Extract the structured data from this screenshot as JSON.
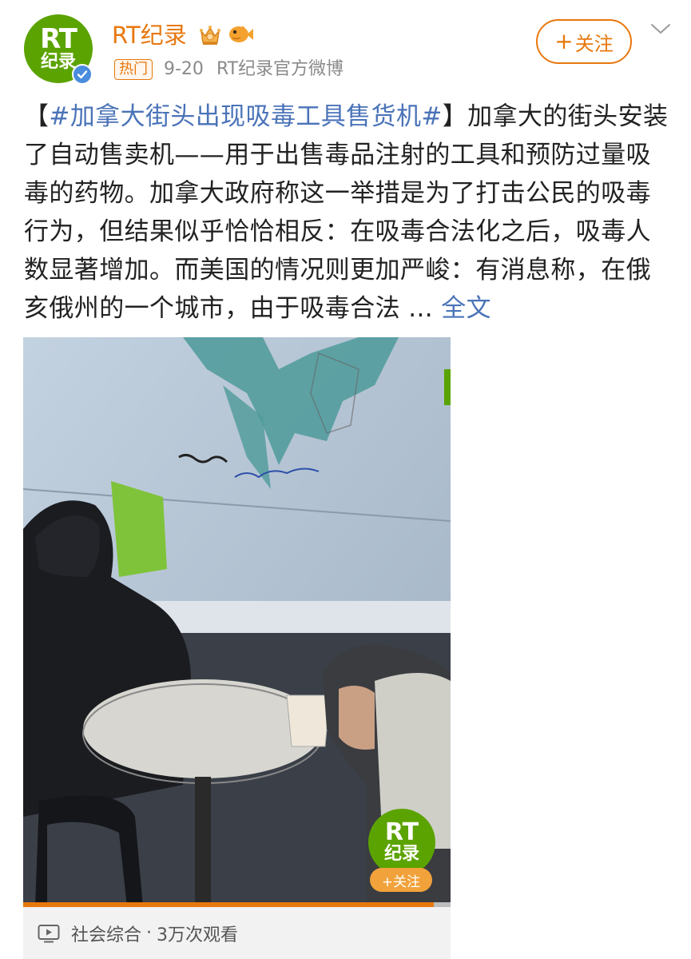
{
  "header": {
    "avatar": {
      "line1": "RT",
      "line2": "纪录"
    },
    "account_name": "RT纪录",
    "hot_tag": "热门",
    "date": "9-20",
    "source": "RT纪录官方微博",
    "follow_label": "关注",
    "follow_plus": "+"
  },
  "post": {
    "bracket_open": "【",
    "hashtag": "#加拿大街头出现吸毒工具售货机#",
    "bracket_close": "】",
    "body": "加拿大的街头安装了自动售卖机——用于出售毒品注射的工具和预防过量吸毒的药物。加拿大政府称这一举措是为了打击公民的吸毒行为，但结果似乎恰恰相反：在吸毒合法化之后，吸毒人数显著增加。而美国的情况则更加严峻：有消息称，在俄亥俄州的一个城市，由于吸毒合法 ... ",
    "full_text_link": "全文"
  },
  "video": {
    "watermark": {
      "line1": "RT",
      "line2": "纪录",
      "follow_label": "+关注"
    },
    "progress_fraction": 0.96,
    "category": "社会综合",
    "separator": "·",
    "views": "3万次观看"
  },
  "colors": {
    "accent": "#e8780e",
    "link": "#4a73b8",
    "brand_green": "#5ba300",
    "verified_blue": "#4a8cde"
  },
  "icons": [
    "verified-icon",
    "crown-badge-icon",
    "fish-badge-icon",
    "chevron-down-icon",
    "video-play-icon"
  ]
}
